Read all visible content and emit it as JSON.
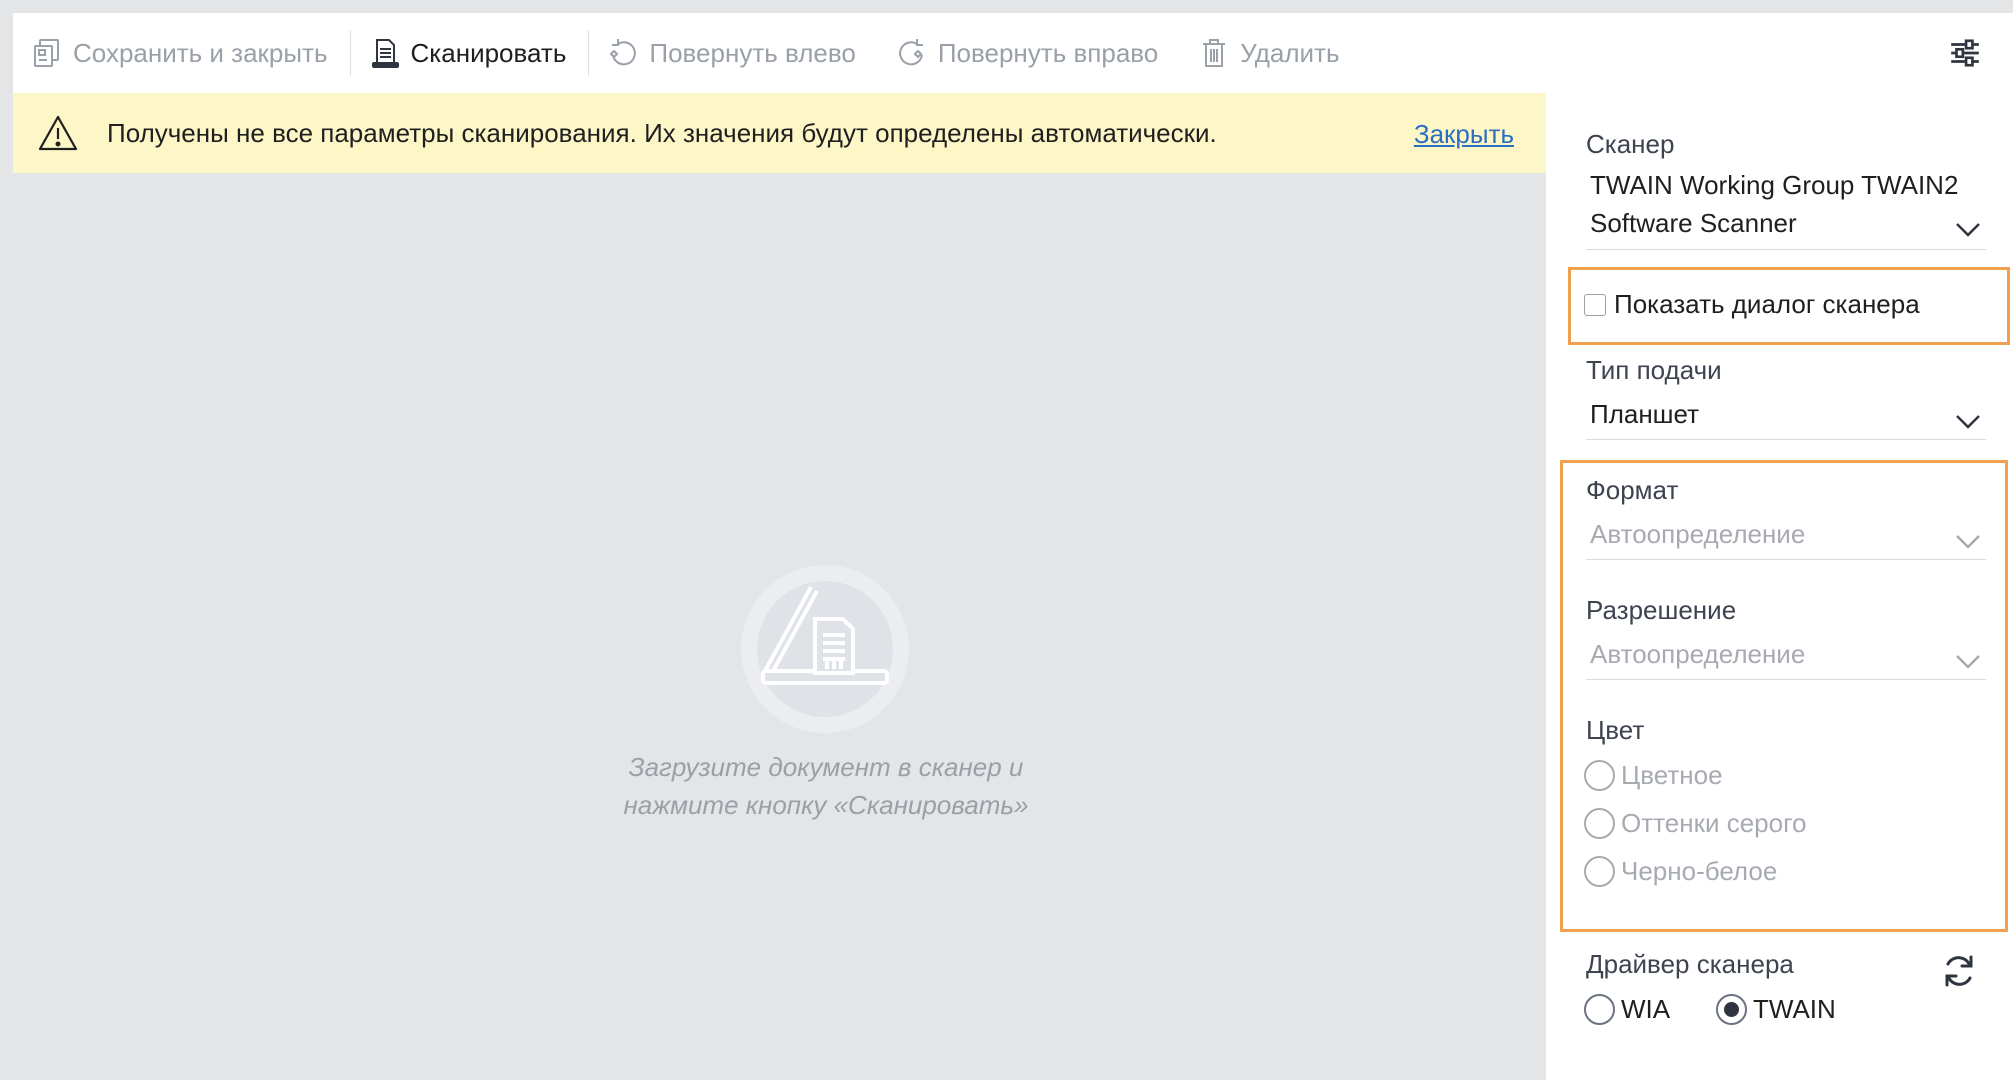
{
  "toolbar": {
    "save_close_label": "Сохранить и закрыть",
    "scan_label": "Сканировать",
    "rotate_left_label": "Повернуть влево",
    "rotate_right_label": "Повернуть вправо",
    "delete_label": "Удалить",
    "settings_icon": "sliders-icon"
  },
  "warning": {
    "icon": "warning-triangle-icon",
    "text": "Получены не все параметры сканирования. Их значения будут определены автоматически.",
    "close_label": "Закрыть"
  },
  "empty_state": {
    "icon": "scanner-document-icon",
    "line1": "Загрузите документ в сканер и",
    "line2": "нажмите кнопку «Сканировать»"
  },
  "panel": {
    "scanner": {
      "label": "Сканер",
      "value_line1": "TWAIN Working Group TWAIN2",
      "value_line2": "Software Scanner"
    },
    "show_dialog": {
      "label": "Показать диалог сканера",
      "checked": false
    },
    "feed_type": {
      "label": "Тип подачи",
      "value": "Планшет"
    },
    "format": {
      "label": "Формат",
      "value": "Автоопределение"
    },
    "resolution": {
      "label": "Разрешение",
      "value": "Автоопределение"
    },
    "color": {
      "label": "Цвет",
      "options": [
        "Цветное",
        "Оттенки серого",
        "Черно-белое"
      ]
    },
    "driver": {
      "label": "Драйвер сканера",
      "options": [
        "WIA",
        "TWAIN"
      ],
      "selected": "TWAIN",
      "refresh_icon": "refresh-icon"
    }
  },
  "colors": {
    "highlight_border": "#f0a150",
    "warning_bg": "#fdf7c8",
    "link": "#2a6fc1",
    "canvas_bg": "#e4e5e7"
  }
}
